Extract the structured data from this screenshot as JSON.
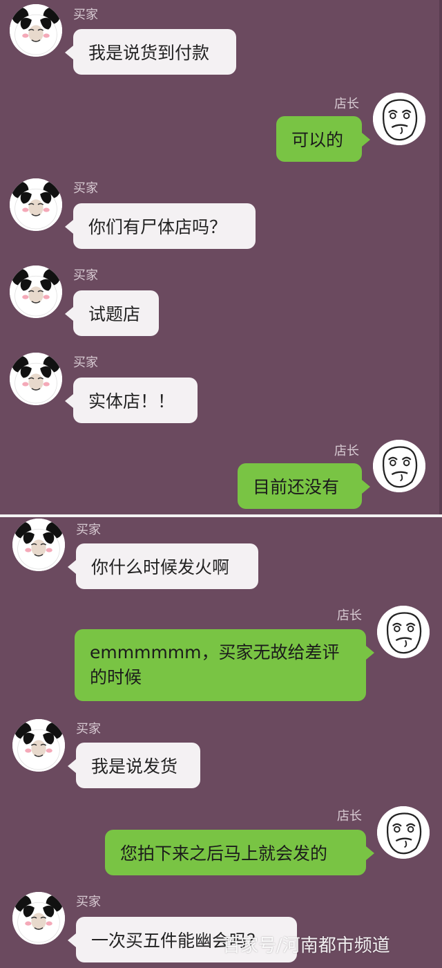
{
  "names": {
    "buyer": "买家",
    "owner": "店长"
  },
  "messages": [
    {
      "sender": "buyer",
      "text": "我是说货到付款"
    },
    {
      "sender": "owner",
      "text": "可以的"
    },
    {
      "sender": "buyer",
      "text": "你们有尸体店吗？"
    },
    {
      "sender": "buyer",
      "text": "试题店"
    },
    {
      "sender": "buyer",
      "text": "实体店！！"
    },
    {
      "sender": "owner",
      "text": "目前还没有"
    },
    {
      "sender": "buyer",
      "text": "你什么时候发火啊"
    },
    {
      "sender": "owner",
      "text": "emmmmmm，买家无故给差评的时候"
    },
    {
      "sender": "buyer",
      "text": "我是说发货"
    },
    {
      "sender": "owner",
      "text": "您拍下来之后马上就会发的"
    },
    {
      "sender": "buyer",
      "text": "一次买五件能幽会吗？"
    }
  ],
  "watermark": "百家号/河南都市频道",
  "colors": {
    "background": "#6b4a5f",
    "buyer_bubble": "#f4f1f3",
    "owner_bubble": "#79c444"
  },
  "icons": {
    "buyer_avatar": "panda-meme-icon",
    "owner_avatar": "troll-face-icon"
  }
}
